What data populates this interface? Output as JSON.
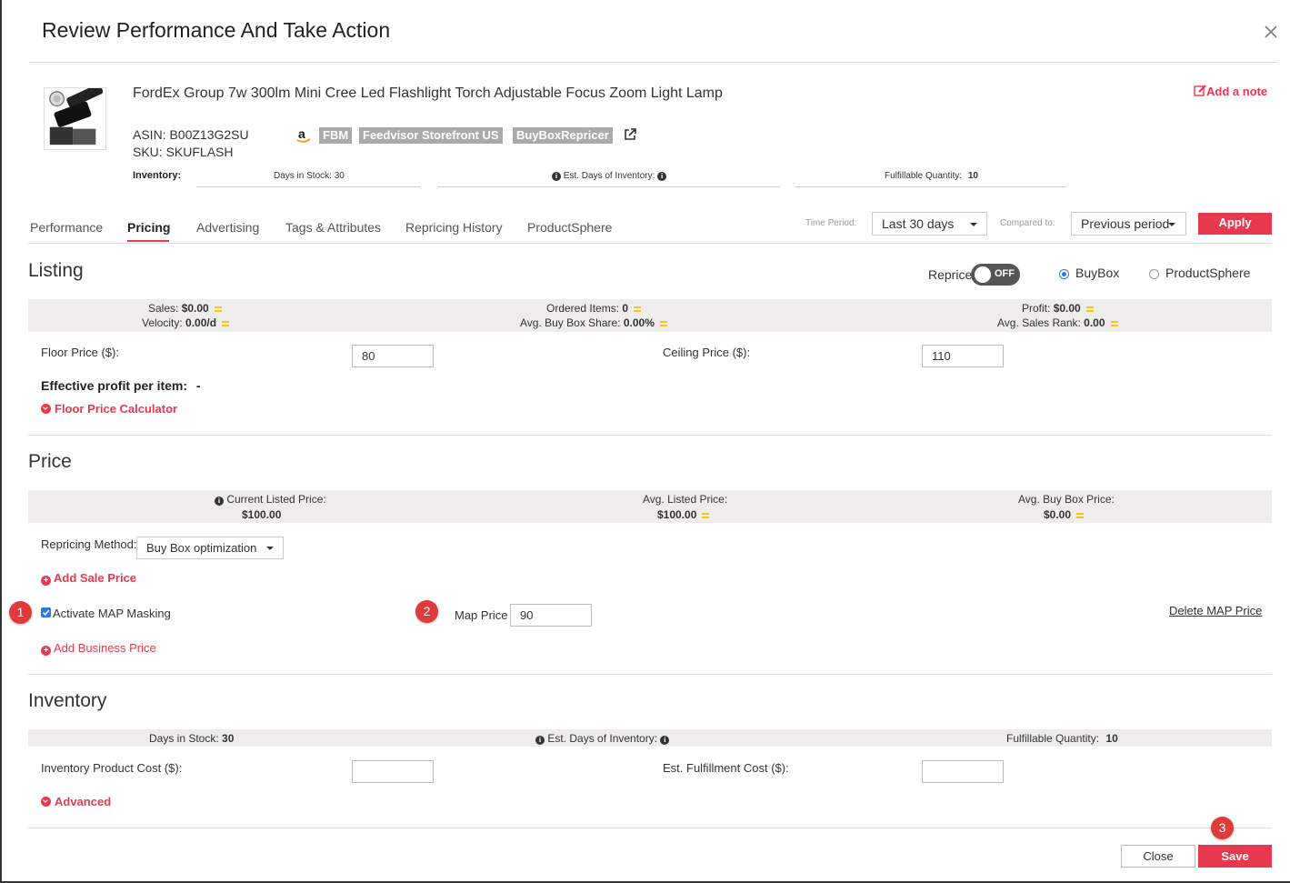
{
  "dialog": {
    "title": "Review Performance And Take Action"
  },
  "product": {
    "title": "FordEx Group 7w 300lm Mini Cree Led Flashlight Torch Adjustable Focus Zoom Light Lamp",
    "asin": "ASIN: B00Z13G2SU",
    "sku": "SKU: SKUFLASH",
    "tags": [
      "FBM",
      "Feedvisor Storefront US",
      "BuyBoxRepricer"
    ],
    "add_note": "Add a note",
    "inventory_label": "Inventory:",
    "days_in_stock": "Days in Stock: 30",
    "est_days": "Est. Days of Inventory:",
    "fulfillable": "Fulfillable Quantity:",
    "fulfillable_value": "10"
  },
  "tabs": [
    "Performance",
    "Pricing",
    "Advertising",
    "Tags & Attributes",
    "Repricing History",
    "ProductSphere"
  ],
  "active_tab": "Pricing",
  "filters": {
    "time_period_label": "Time Period:",
    "time_period_value": "Last 30 days",
    "compared_label": "Compared to:",
    "compared_value": "Previous period",
    "apply": "Apply"
  },
  "listing": {
    "title": "Listing",
    "reprice_label": "Reprice",
    "toggle_text": "OFF",
    "radio_buybox": "BuyBox",
    "radio_productsphere": "ProductSphere",
    "stats": {
      "sales_label": "Sales:",
      "sales_value": "$0.00",
      "velocity_label": "Velocity:",
      "velocity_value": "0.00/d",
      "ordered_label": "Ordered Items:",
      "ordered_value": "0",
      "bbshare_label": "Avg. Buy Box Share:",
      "bbshare_value": "0.00%",
      "profit_label": "Profit:",
      "profit_value": "$0.00",
      "rank_label": "Avg. Sales Rank:",
      "rank_value": "0.00"
    },
    "floor_label": "Floor Price ($):",
    "floor_value": "80",
    "ceiling_label": "Ceiling Price ($):",
    "ceiling_value": "110",
    "effective_label": "Effective profit per item:",
    "effective_value": "-",
    "floor_calc": "Floor Price Calculator"
  },
  "price": {
    "title": "Price",
    "current_label": "Current Listed Price:",
    "current_value": "$100.00",
    "avg_listed_label": "Avg. Listed Price:",
    "avg_listed_value": "$100.00",
    "avg_bb_label": "Avg. Buy Box Price:",
    "avg_bb_value": "$0.00",
    "method_label": "Repricing Method:",
    "method_value": "Buy Box optimization",
    "add_sale": "Add Sale Price",
    "map_masking": "Activate MAP Masking",
    "map_price_label": "Map Price",
    "map_price_value": "90",
    "delete_map": "Delete MAP Price",
    "add_business": "Add Business Price"
  },
  "inventory": {
    "title": "Inventory",
    "days_label": "Days in Stock:",
    "days_value": "30",
    "est_label": "Est. Days of Inventory:",
    "fulfill_label": "Fulfillable Quantity:",
    "fulfill_value": "10",
    "cost_label": "Inventory Product Cost ($):",
    "fulfillment_label": "Est. Fulfillment Cost ($):",
    "advanced": "Advanced"
  },
  "footer": {
    "close": "Close",
    "save": "Save"
  },
  "callouts": [
    "1",
    "2",
    "3"
  ],
  "colors": {
    "accent": "#e8384f",
    "band": "#efedec",
    "callout": "#e03a3a"
  }
}
